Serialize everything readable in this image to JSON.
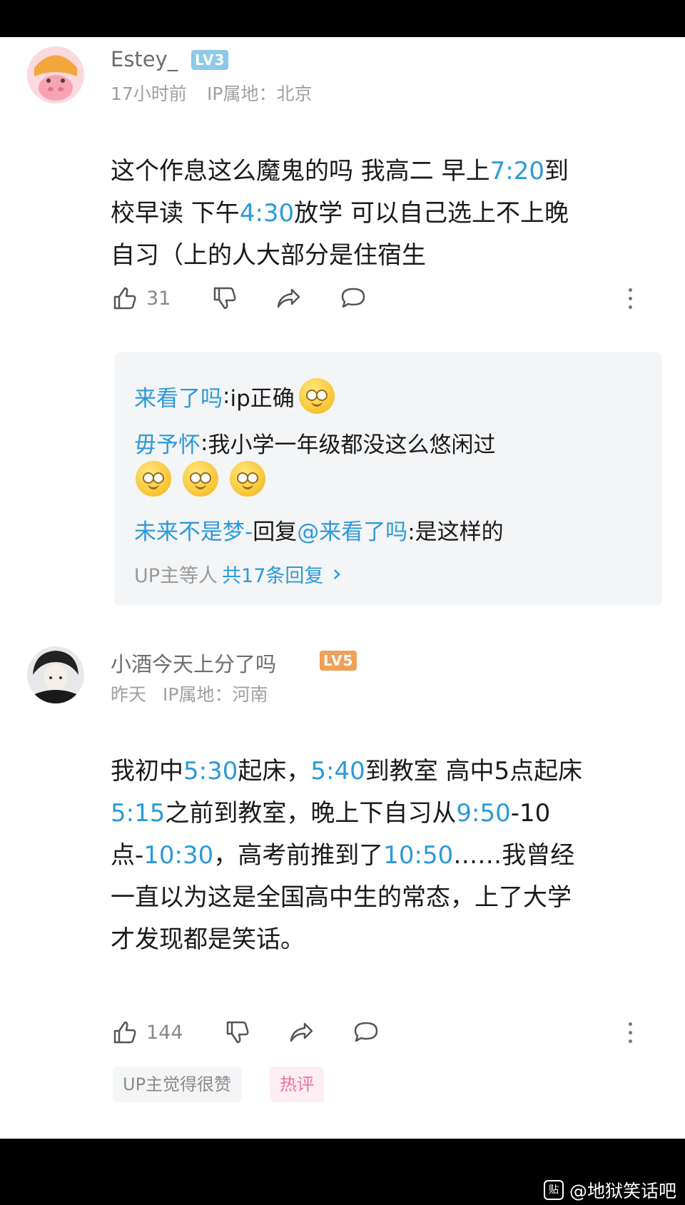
{
  "comments": [
    {
      "username": "Estey_",
      "level": "LV3",
      "time": "17小时前",
      "ip": "IP属地：北京",
      "content": [
        [
          "这个作息这么魔鬼的吗 我高二 早上",
          "7:20",
          "到"
        ],
        [
          "校早读 下午",
          "4:30",
          "放学 可以自己选上不上晚"
        ],
        [
          "自习（上的人大部分是住宿生"
        ]
      ],
      "likes": "31",
      "replies": [
        {
          "name": "来看了吗",
          "sep": ":",
          "text": " ip正确"
        },
        {
          "name": "毋予怀",
          "sep": ":",
          "text": " 我小学一年级都没这么悠闲过"
        },
        {
          "name": "未来不是梦-",
          "sep": "",
          "text": " 回复 ",
          "mention": "@来看了吗",
          "tail": " :是这样的"
        }
      ],
      "more_replies_prefix": "UP主等人",
      "more_replies_count": "共17条回复",
      "more_replies_arrow": "›"
    },
    {
      "username": "小酒今天上分了吗",
      "level": "LV5",
      "time": "昨天",
      "ip": "IP属地：河南",
      "content": [
        [
          "我初中",
          "5:30",
          "起床，",
          "5:40",
          "到教室  高中5点起床"
        ],
        [
          "5:15",
          "之前到教室，晚上下自习从",
          "9:50",
          "-10"
        ],
        [
          "点-",
          "10:30",
          "，高考前推到了",
          "10:50",
          "……我曾经"
        ],
        [
          "一直以为这是全国高中生的常态，上了大学"
        ],
        [
          "才发现都是笑话。"
        ]
      ],
      "likes": "144",
      "tags": [
        "UP主觉得很赞",
        "热评"
      ]
    }
  ],
  "watermark": "@地狱笑话吧",
  "watermark_logo": "贴",
  "colors": {
    "link": "#2b9ad8",
    "lv3": "#8ec9e8",
    "lv5": "#f0a057",
    "hot_tag_bg": "#fdeef3",
    "hot_tag_text": "#f0709a"
  },
  "icons": [
    "like-icon",
    "dislike-icon",
    "share-icon",
    "reply-icon",
    "more-icon",
    "chevron-right-icon"
  ]
}
